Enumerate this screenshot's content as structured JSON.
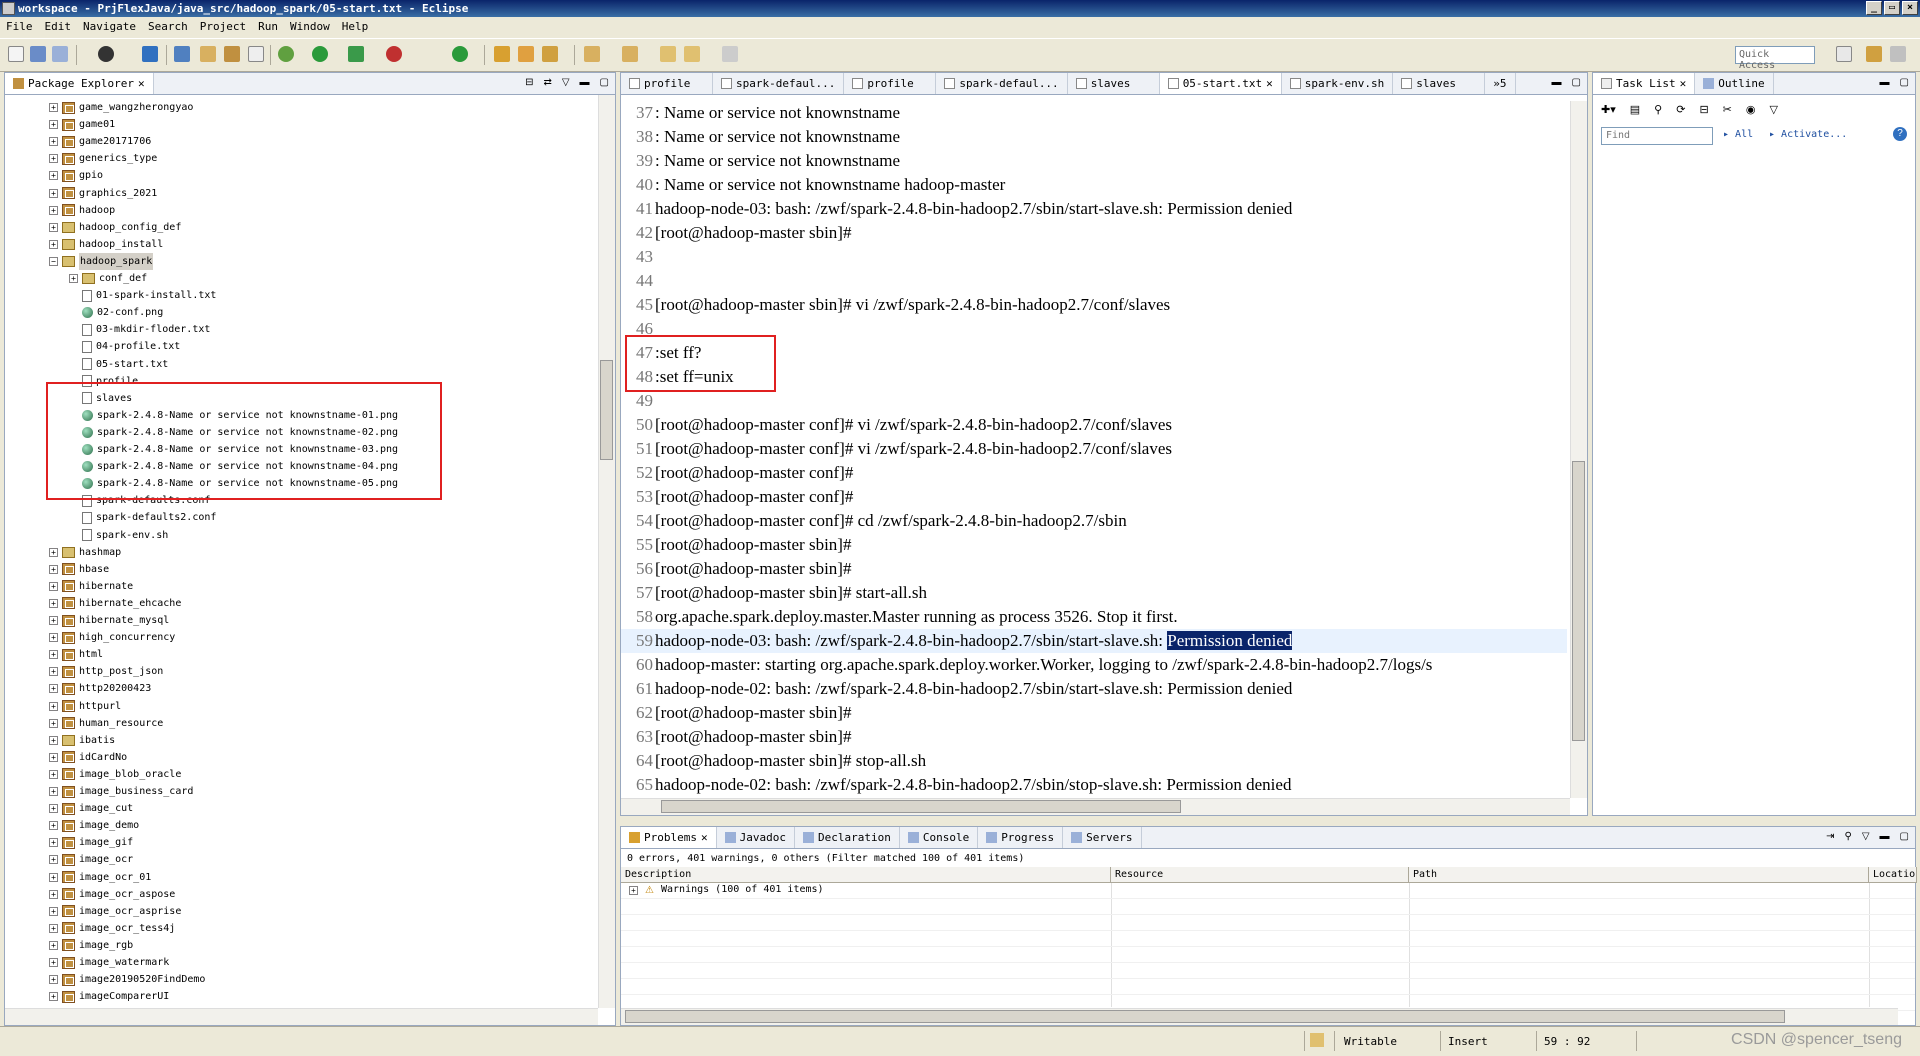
{
  "window": {
    "title": "workspace - PrjFlexJava/java_src/hadoop_spark/05-start.txt - Eclipse"
  },
  "menu": [
    "File",
    "Edit",
    "Navigate",
    "Search",
    "Project",
    "Run",
    "Window",
    "Help"
  ],
  "toolbar": {
    "quick_access_placeholder": "Quick Access"
  },
  "package_explorer": {
    "title": "Package Explorer",
    "items": [
      {
        "label": "game_wangzherongyao",
        "type": "project",
        "depth": 0,
        "expanded": false
      },
      {
        "label": "game01",
        "type": "project",
        "depth": 0,
        "expanded": false
      },
      {
        "label": "game20171706",
        "type": "project",
        "depth": 0,
        "expanded": false
      },
      {
        "label": "generics_type",
        "type": "project",
        "depth": 0,
        "expanded": false
      },
      {
        "label": "gpio",
        "type": "project",
        "depth": 0,
        "expanded": false
      },
      {
        "label": "graphics_2021",
        "type": "project",
        "depth": 0,
        "expanded": false
      },
      {
        "label": "hadoop",
        "type": "project",
        "depth": 0,
        "expanded": false
      },
      {
        "label": "hadoop_config_def",
        "type": "folder",
        "depth": 0,
        "expanded": false
      },
      {
        "label": "hadoop_install",
        "type": "folder",
        "depth": 0,
        "expanded": false
      },
      {
        "label": "hadoop_spark",
        "type": "folder",
        "depth": 0,
        "expanded": true,
        "selected": true
      },
      {
        "label": "conf_def",
        "type": "folder",
        "depth": 1,
        "expanded": false
      },
      {
        "label": "01-spark-install.txt",
        "type": "txt",
        "depth": 1
      },
      {
        "label": "02-conf.png",
        "type": "png",
        "depth": 1
      },
      {
        "label": "03-mkdir-floder.txt",
        "type": "txt",
        "depth": 1
      },
      {
        "label": "04-profile.txt",
        "type": "txt",
        "depth": 1
      },
      {
        "label": "05-start.txt",
        "type": "txt",
        "depth": 1
      },
      {
        "label": "profile",
        "type": "txt",
        "depth": 1
      },
      {
        "label": "slaves",
        "type": "txt",
        "depth": 1
      },
      {
        "label": "spark-2.4.8-Name or service not knownstname-01.png",
        "type": "png",
        "depth": 1
      },
      {
        "label": "spark-2.4.8-Name or service not knownstname-02.png",
        "type": "png",
        "depth": 1
      },
      {
        "label": "spark-2.4.8-Name or service not knownstname-03.png",
        "type": "png",
        "depth": 1
      },
      {
        "label": "spark-2.4.8-Name or service not knownstname-04.png",
        "type": "png",
        "depth": 1
      },
      {
        "label": "spark-2.4.8-Name or service not knownstname-05.png",
        "type": "png",
        "depth": 1
      },
      {
        "label": "spark-defaults.conf",
        "type": "txt",
        "depth": 1
      },
      {
        "label": "spark-defaults2.conf",
        "type": "txt",
        "depth": 1
      },
      {
        "label": "spark-env.sh",
        "type": "txt",
        "depth": 1
      },
      {
        "label": "hashmap",
        "type": "folder",
        "depth": 0,
        "expanded": false
      },
      {
        "label": "hbase",
        "type": "project",
        "depth": 0,
        "expanded": false
      },
      {
        "label": "hibernate",
        "type": "project",
        "depth": 0,
        "expanded": false
      },
      {
        "label": "hibernate_ehcache",
        "type": "project",
        "depth": 0,
        "expanded": false
      },
      {
        "label": "hibernate_mysql",
        "type": "project",
        "depth": 0,
        "expanded": false
      },
      {
        "label": "high_concurrency",
        "type": "project",
        "depth": 0,
        "expanded": false
      },
      {
        "label": "html",
        "type": "project",
        "depth": 0,
        "expanded": false
      },
      {
        "label": "http_post_json",
        "type": "project",
        "depth": 0,
        "expanded": false
      },
      {
        "label": "http20200423",
        "type": "project",
        "depth": 0,
        "expanded": false
      },
      {
        "label": "httpurl",
        "type": "project",
        "depth": 0,
        "expanded": false
      },
      {
        "label": "human_resource",
        "type": "project",
        "depth": 0,
        "expanded": false
      },
      {
        "label": "ibatis",
        "type": "folder",
        "depth": 0,
        "expanded": false
      },
      {
        "label": "idCardNo",
        "type": "project",
        "depth": 0,
        "expanded": false
      },
      {
        "label": "image_blob_oracle",
        "type": "project",
        "depth": 0,
        "expanded": false
      },
      {
        "label": "image_business_card",
        "type": "project",
        "depth": 0,
        "expanded": false
      },
      {
        "label": "image_cut",
        "type": "project",
        "depth": 0,
        "expanded": false
      },
      {
        "label": "image_demo",
        "type": "project",
        "depth": 0,
        "expanded": false
      },
      {
        "label": "image_gif",
        "type": "project",
        "depth": 0,
        "expanded": false
      },
      {
        "label": "image_ocr",
        "type": "project",
        "depth": 0,
        "expanded": false
      },
      {
        "label": "image_ocr_01",
        "type": "project",
        "depth": 0,
        "expanded": false
      },
      {
        "label": "image_ocr_aspose",
        "type": "project",
        "depth": 0,
        "expanded": false
      },
      {
        "label": "image_ocr_asprise",
        "type": "project",
        "depth": 0,
        "expanded": false
      },
      {
        "label": "image_ocr_tess4j",
        "type": "project",
        "depth": 0,
        "expanded": false
      },
      {
        "label": "image_rgb",
        "type": "project",
        "depth": 0,
        "expanded": false
      },
      {
        "label": "image_watermark",
        "type": "project",
        "depth": 0,
        "expanded": false
      },
      {
        "label": "image20190520FindDemo",
        "type": "project",
        "depth": 0,
        "expanded": false
      },
      {
        "label": "imageComparerUI",
        "type": "project",
        "depth": 0,
        "expanded": false
      }
    ]
  },
  "editor": {
    "tabs": [
      {
        "label": "profile",
        "active": false
      },
      {
        "label": "spark-defaul...",
        "active": false
      },
      {
        "label": "profile",
        "active": false
      },
      {
        "label": "spark-defaul...",
        "active": false
      },
      {
        "label": "slaves",
        "active": false
      },
      {
        "label": "05-start.txt",
        "active": true
      },
      {
        "label": "spark-env.sh",
        "active": false
      },
      {
        "label": "slaves",
        "active": false
      }
    ],
    "overflow_label": "»5",
    "lines": [
      {
        "n": "37",
        "text": ": Name or service not knownstname"
      },
      {
        "n": "38",
        "text": ": Name or service not knownstname"
      },
      {
        "n": "39",
        "text": ": Name or service not knownstname"
      },
      {
        "n": "40",
        "text": ": Name or service not knownstname hadoop-master"
      },
      {
        "n": "41",
        "text": "hadoop-node-03: bash: /zwf/spark-2.4.8-bin-hadoop2.7/sbin/start-slave.sh: Permission denied"
      },
      {
        "n": "42",
        "text": "[root@hadoop-master sbin]#"
      },
      {
        "n": "43",
        "text": ""
      },
      {
        "n": "44",
        "text": ""
      },
      {
        "n": "45",
        "text": "[root@hadoop-master sbin]# vi /zwf/spark-2.4.8-bin-hadoop2.7/conf/slaves"
      },
      {
        "n": "46",
        "text": ""
      },
      {
        "n": "47",
        "text": ":set ff?"
      },
      {
        "n": "48",
        "text": ":set ff=unix"
      },
      {
        "n": "49",
        "text": ""
      },
      {
        "n": "50",
        "text": "[root@hadoop-master conf]# vi /zwf/spark-2.4.8-bin-hadoop2.7/conf/slaves"
      },
      {
        "n": "51",
        "text": "[root@hadoop-master conf]# vi /zwf/spark-2.4.8-bin-hadoop2.7/conf/slaves"
      },
      {
        "n": "52",
        "text": "[root@hadoop-master conf]#"
      },
      {
        "n": "53",
        "text": "[root@hadoop-master conf]#"
      },
      {
        "n": "54",
        "text": "[root@hadoop-master conf]# cd /zwf/spark-2.4.8-bin-hadoop2.7/sbin"
      },
      {
        "n": "55",
        "text": "[root@hadoop-master sbin]#"
      },
      {
        "n": "56",
        "text": "[root@hadoop-master sbin]#"
      },
      {
        "n": "57",
        "text": "[root@hadoop-master sbin]# start-all.sh"
      },
      {
        "n": "58",
        "text": "org.apache.spark.deploy.master.Master running as process 3526.  Stop it first."
      },
      {
        "n": "59",
        "text": "hadoop-node-03: bash: /zwf/spark-2.4.8-bin-hadoop2.7/sbin/start-slave.sh: ",
        "highlight": "Permission denied",
        "current": true
      },
      {
        "n": "60",
        "text": "hadoop-master: starting org.apache.spark.deploy.worker.Worker, logging to /zwf/spark-2.4.8-bin-hadoop2.7/logs/s"
      },
      {
        "n": "61",
        "text": "hadoop-node-02: bash: /zwf/spark-2.4.8-bin-hadoop2.7/sbin/start-slave.sh: Permission denied"
      },
      {
        "n": "62",
        "text": "[root@hadoop-master sbin]#"
      },
      {
        "n": "63",
        "text": "[root@hadoop-master sbin]#"
      },
      {
        "n": "64",
        "text": "[root@hadoop-master sbin]# stop-all.sh"
      },
      {
        "n": "65",
        "text": "hadoop-node-02: bash: /zwf/spark-2.4.8-bin-hadoop2.7/sbin/stop-slave.sh: Permission denied"
      }
    ]
  },
  "task_list": {
    "tabs": [
      {
        "label": "Task List"
      },
      {
        "label": "Outline"
      }
    ],
    "find_placeholder": "Find",
    "all_label": "All",
    "activate_label": "Activate..."
  },
  "problems": {
    "tabs": [
      {
        "label": "Problems",
        "active": true
      },
      {
        "label": "Javadoc",
        "active": false
      },
      {
        "label": "Declaration",
        "active": false
      },
      {
        "label": "Console",
        "active": false
      },
      {
        "label": "Progress",
        "active": false
      },
      {
        "label": "Servers",
        "active": false
      }
    ],
    "summary": "0 errors, 401 warnings, 0 others (Filter matched 100 of 401 items)",
    "columns": [
      "Description",
      "Resource",
      "Path",
      "Locatio"
    ],
    "rows": [
      {
        "description": "Warnings (100 of 401 items)"
      }
    ]
  },
  "status": {
    "writable": "Writable",
    "insert": "Insert",
    "position": "59 : 92"
  },
  "watermark": "CSDN @spencer_tseng",
  "colors": {
    "selection": "#0a246a",
    "annotation_red": "#e02020",
    "link_blue": "#1f4fa0"
  }
}
